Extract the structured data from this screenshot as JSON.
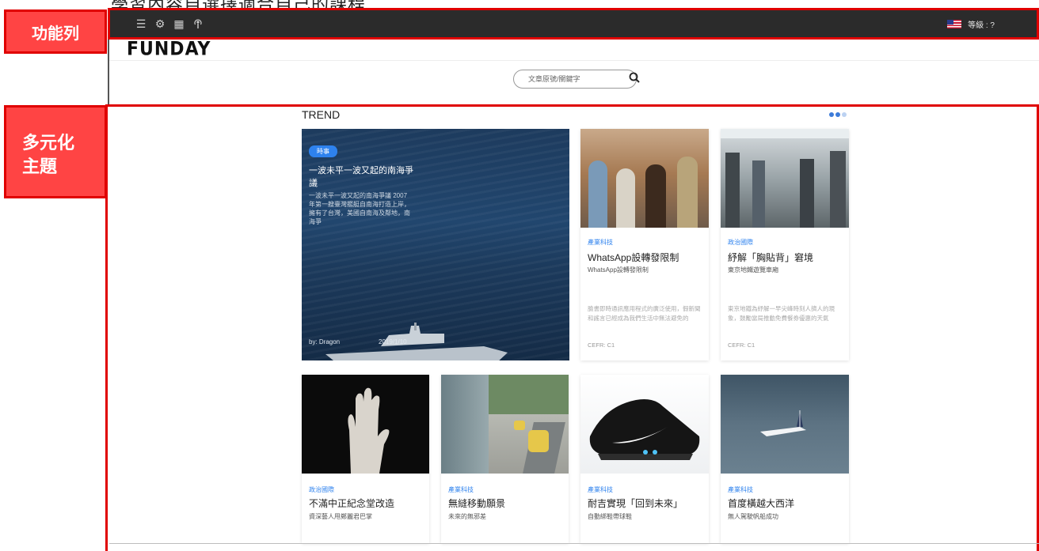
{
  "caption": "學習內容自選擇適合自己的課程",
  "callouts": {
    "toolbar": "功能列",
    "diverse_topics_line1": "多元化",
    "diverse_topics_line2": "主題"
  },
  "navbar": {
    "icons": [
      "menu-icon",
      "gear-icon",
      "calendar-icon",
      "podcast-icon"
    ],
    "level_label": "等級 : ?"
  },
  "brand": {
    "logo": "FUNDAY"
  },
  "search": {
    "placeholder": "文章原號/關鍵字"
  },
  "trend": {
    "title": "TREND",
    "featured": {
      "badge": "時事",
      "title": "一波未平一波又起的南海爭議",
      "description": "一波未平一波又起的南海爭議 2007年第一艘臺灣艦艇自南海打造上岸，擁有了台灣，美國自南海及鄰地，南海爭",
      "author": "by: Dragon",
      "date": "2019/1/10"
    },
    "cards_top": [
      {
        "category": "產業科技",
        "title": "WhatsApp設轉發限制",
        "subtitle": "WhatsApp設轉發限制",
        "description": "臉書即時通訊應用程式的廣泛使用，假新聞和謠言已經成為我們生活中無法避免的",
        "level": "CEFR: C1"
      },
      {
        "category": "政治國際",
        "title": "紓解「胸貼背」窘境",
        "subtitle": "東京地鐵遊覽車廂",
        "description": "東京地鐵為紓解一早尖峰時刻人擠人的現象，鼓勵當局推動免費餐券優惠的天氣",
        "level": "CEFR: C1"
      }
    ],
    "cards_bottom": [
      {
        "category": "政治國際",
        "title": "不滿中正紀念堂改造",
        "subtitle": "資深藝人甩鄭麗君巴掌"
      },
      {
        "category": "產業科技",
        "title": "無縫移動願景",
        "subtitle": "未來的無邪差"
      },
      {
        "category": "產業科技",
        "title": "耐吉實現「回到未來」",
        "subtitle": "自動綁鞋帶球鞋"
      },
      {
        "category": "產業科技",
        "title": "首度橫越大西洋",
        "subtitle": "無人駕駛帆船成功"
      }
    ]
  }
}
